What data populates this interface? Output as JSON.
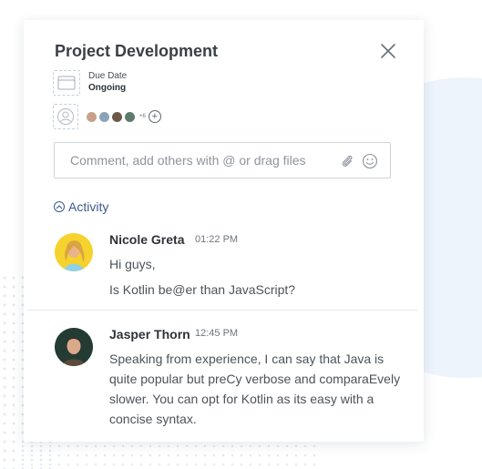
{
  "task": {
    "title": "Project Development",
    "due_date_label": "Due Date",
    "due_date_value": "Ongoing"
  },
  "members": {
    "more_count": "+6",
    "avatar_colors": [
      "#c8a08a",
      "#8aa3b8",
      "#6b5a4a",
      "#5d7a6b"
    ]
  },
  "comment": {
    "placeholder": "Comment, add others with @ or drag files"
  },
  "activity": {
    "label": "Activity",
    "messages": [
      {
        "author": "Nicole Greta",
        "time": "01:22 PM",
        "lines": [
          "Hi guys,",
          "Is Kotlin be@er than JavaScript?"
        ]
      },
      {
        "author": "Jasper Thorn",
        "time": "12:45 PM",
        "lines": [
          "Speaking from experience, I can say that Java is",
          "quite popular but preCy verbose and comparaEvely",
          "slower. You can opt for Kotlin as its easy with a",
          "concise syntax."
        ]
      }
    ]
  },
  "colors": {
    "accent": "#3d5a8a",
    "background_circle": "#eef4fc",
    "avatar1_bg": "#f6d22e"
  }
}
